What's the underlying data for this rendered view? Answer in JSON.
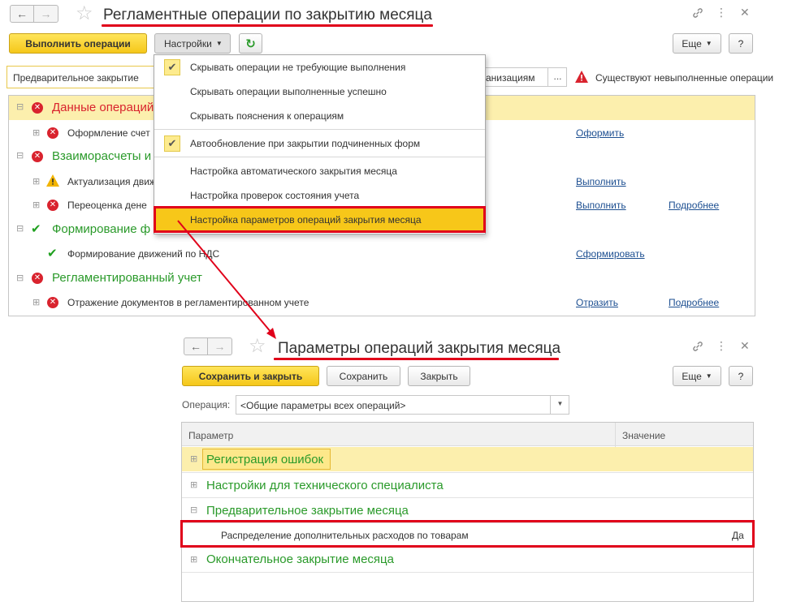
{
  "window1": {
    "title": "Регламентные операции по закрытию месяца",
    "toolbar": {
      "execute_label": "Выполнить операции",
      "settings_label": "Настройки",
      "more_label": "Еще",
      "help_label": "?"
    },
    "period_field_value": "Предварительное закрытие",
    "org_field_value": "анизациям",
    "warning_text": "Существуют невыполненные операции",
    "groups": [
      {
        "name": "Данные операций",
        "status": "error"
      },
      {
        "name": "Взаиморасчеты и",
        "status": "error"
      },
      {
        "name": "Формирование ф",
        "status": "ok"
      },
      {
        "name": "Регламентированный учет",
        "status": "error"
      }
    ],
    "rows": [
      {
        "text": "Оформление счет",
        "status": "error",
        "action": "Оформить",
        "details": ""
      },
      {
        "text": "Актуализация движ",
        "status": "warning",
        "action": "Выполнить",
        "details": ""
      },
      {
        "text": "Переоценка дене",
        "status": "error",
        "action": "Выполнить",
        "details": "Подробнее"
      },
      {
        "text": "Формирование движений по НДС",
        "status": "ok",
        "action": "Сформировать",
        "details": ""
      },
      {
        "text": "Отражение документов в регламентированном учете",
        "status": "error",
        "action": "Отразить",
        "details": "Подробнее"
      }
    ]
  },
  "settings_menu": {
    "items": [
      {
        "label": "Скрывать операции не требующие выполнения",
        "checked": true
      },
      {
        "label": "Скрывать операции выполненные успешно",
        "checked": false
      },
      {
        "label": "Скрывать пояснения к операциям",
        "checked": false
      },
      {
        "label": "Автообновление при закрытии подчиненных форм",
        "checked": true
      },
      {
        "label": "Настройка автоматического закрытия месяца",
        "checked": false
      },
      {
        "label": "Настройка проверок состояния учета",
        "checked": false
      },
      {
        "label": "Настройка параметров операций закрытия месяца",
        "checked": false,
        "highlighted": true
      }
    ]
  },
  "window2": {
    "title": "Параметры операций закрытия месяца",
    "toolbar": {
      "save_close_label": "Сохранить и закрыть",
      "save_label": "Сохранить",
      "close_label": "Закрыть",
      "more_label": "Еще",
      "help_label": "?"
    },
    "operation_label": "Операция:",
    "operation_value": "<Общие параметры всех операций>",
    "table": {
      "col_param": "Параметр",
      "col_value": "Значение",
      "rows": [
        {
          "name": "Регистрация ошибок",
          "type": "group",
          "expanded": false
        },
        {
          "name": "Настройки для технического специалиста",
          "type": "group",
          "expanded": false
        },
        {
          "name": "Предварительное закрытие месяца",
          "type": "group",
          "expanded": true
        },
        {
          "name": "Распределение дополнительных расходов по товарам",
          "type": "param",
          "value": "Да"
        },
        {
          "name": "Окончательное закрытие месяца",
          "type": "group",
          "expanded": false
        }
      ]
    }
  },
  "colors": {
    "accent_yellow": "#f5c71a",
    "error_red": "#d9232e",
    "ok_green": "#1fa01f",
    "group_green": "#2a9a2a",
    "link_blue": "#1d4f91",
    "highlight_red": "#e0001a"
  }
}
